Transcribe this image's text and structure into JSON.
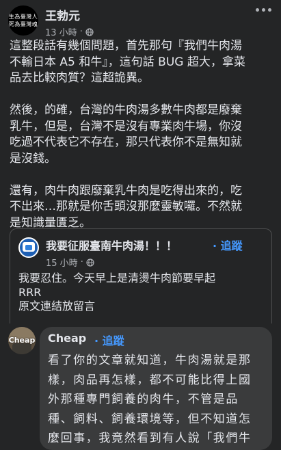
{
  "post": {
    "avatar_text": [
      "生為臺灣人",
      "死為臺灣魂"
    ],
    "author": "王勃元",
    "time": "13 小時",
    "separator": "·",
    "paragraphs": [
      [
        "這整段話有幾個問題，首先那句『我們牛肉湯",
        "不輸日本 A5 和牛』，這句話 BUG 超大，拿菜",
        "品去比較肉質？這超詭異。"
      ],
      [
        "然後，的確，台灣的牛肉湯多數牛肉都是廢棄",
        "乳牛，但是，台灣不是沒有專業肉牛場，你沒",
        "吃過不代表它不存在，那只代表你不是無知就",
        "是沒錢。"
      ],
      [
        "還有，肉牛肉跟廢棄乳牛肉是吃得出來的，吃",
        "不出來…那就是你舌頭沒那麼靈敏囉。不然就",
        "是知識量匱乏。"
      ]
    ]
  },
  "shared": {
    "name": "我要征服臺南牛肉湯！！！",
    "separator": "·",
    "follow": "追蹤",
    "time": "15 小時",
    "lines": [
      "我要忍住。今天早上是清燙牛肉節要早起",
      "RRR",
      "原文連結放留言"
    ]
  },
  "comment": {
    "avatar_label": "Cheap",
    "name": "Cheap",
    "separator": "·",
    "follow": "追蹤",
    "lines": [
      "看了你的文章就知道，牛肉湯就是那",
      "樣，肉品再怎樣，都不可能比得上國",
      "外那種專門飼養的肉牛，不管是品",
      "種、飼料、飼養環境等，但不知道怎",
      "麼回事，我竟然看到有人說「我們牛"
    ]
  }
}
